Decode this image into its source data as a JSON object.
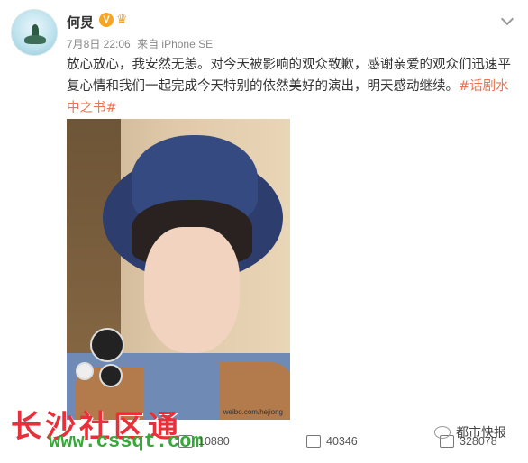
{
  "post": {
    "author": "何炅",
    "verified_badge": "V",
    "timestamp": "7月8日 22:06",
    "source": "来自 iPhone SE",
    "text": "放心放心，我安然无恙。对今天被影响的观众致歉，感谢亲爱的观众们迅速平复心情和我们一起完成今天特别的依然美好的演出，明天感动继续。",
    "hashtag": "#话剧水中之书#",
    "photo_watermark": "weibo.com/hejiong"
  },
  "actions": {
    "repost_count": "10880",
    "comment_count": "40346",
    "like_count": "328078"
  },
  "overlay": {
    "site_name": "长沙社区通",
    "site_url": "www.cssqt.com",
    "wechat_source": "都市快报"
  },
  "colors": {
    "hashtag": "#eb7350",
    "verified": "#f6a623",
    "watermark_red": "#e8303a",
    "watermark_green": "#38a838"
  }
}
